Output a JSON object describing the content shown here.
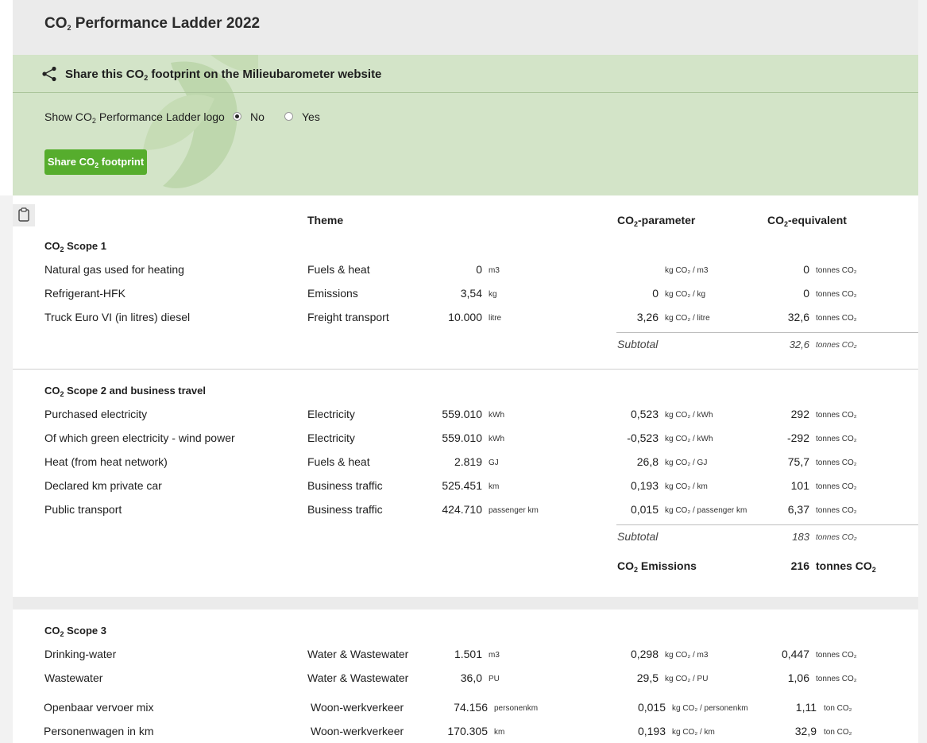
{
  "page_title": {
    "pre": "CO",
    "sub": "2",
    "post": " Performance Ladder 2022"
  },
  "share": {
    "title": {
      "pre": "Share this CO",
      "sub": "2",
      "post": " footprint on the Milieubarometer website"
    },
    "logo_label": {
      "pre": "Show CO",
      "sub": "2",
      "post": " Performance Ladder logo"
    },
    "options": [
      "No",
      "Yes"
    ],
    "selected": "No",
    "button": {
      "pre": "Share CO",
      "sub": "2",
      "post": " footprint"
    }
  },
  "columns": {
    "theme": "Theme",
    "param": {
      "pre": "CO",
      "sub": "2",
      "post": "-parameter"
    },
    "equiv": {
      "pre": "CO",
      "sub": "2",
      "post": "-equivalent"
    }
  },
  "sections": [
    {
      "title": {
        "pre": "CO",
        "sub": "2",
        "post": " Scope 1"
      },
      "rows": [
        {
          "name": "Natural gas used for heating",
          "theme": "Fuels & heat",
          "amount": "0",
          "unit": "m3",
          "factor": "",
          "factor_unit": "kg CO₂ / m3",
          "emission": "0",
          "emission_unit": "tonnes CO₂"
        },
        {
          "name": "Refrigerant-HFK",
          "theme": "Emissions",
          "amount": "3,54",
          "unit": "kg",
          "factor": "0",
          "factor_unit": "kg CO₂ / kg",
          "emission": "0",
          "emission_unit": "tonnes CO₂"
        },
        {
          "name": "Truck Euro VI (in litres) diesel",
          "theme": "Freight transport",
          "amount": "10.000",
          "unit": "litre",
          "factor": "3,26",
          "factor_unit": "kg CO₂ / litre",
          "emission": "32,6",
          "emission_unit": "tonnes CO₂"
        }
      ],
      "subtotal": {
        "label": "Subtotal",
        "value": "32,6",
        "unit": "tonnes CO₂"
      }
    },
    {
      "title": {
        "pre": "CO",
        "sub": "2",
        "post": " Scope 2 and business travel"
      },
      "rows": [
        {
          "name": "Purchased electricity",
          "theme": "Electricity",
          "amount": "559.010",
          "unit": "kWh",
          "factor": "0,523",
          "factor_unit": "kg CO₂ / kWh",
          "emission": "292",
          "emission_unit": "tonnes CO₂"
        },
        {
          "name": "Of which green electricity - wind power",
          "theme": "Electricity",
          "amount": "559.010",
          "unit": "kWh",
          "factor": "-0,523",
          "factor_unit": "kg CO₂ / kWh",
          "emission": "-292",
          "emission_unit": "tonnes CO₂"
        },
        {
          "name": "Heat (from heat network)",
          "theme": "Fuels & heat",
          "amount": "2.819",
          "unit": "GJ",
          "factor": "26,8",
          "factor_unit": "kg CO₂ / GJ",
          "emission": "75,7",
          "emission_unit": "tonnes CO₂"
        },
        {
          "name": "Declared km private car",
          "theme": "Business traffic",
          "amount": "525.451",
          "unit": "km",
          "factor": "0,193",
          "factor_unit": "kg CO₂ / km",
          "emission": "101",
          "emission_unit": "tonnes CO₂"
        },
        {
          "name": "Public transport",
          "theme": "Business traffic",
          "amount": "424.710",
          "unit": "passenger km",
          "factor": "0,015",
          "factor_unit": "kg CO₂ / passenger km",
          "emission": "6,37",
          "emission_unit": "tonnes CO₂"
        }
      ],
      "subtotal": {
        "label": "Subtotal",
        "value": "183",
        "unit": "tonnes CO₂"
      },
      "total": {
        "label": {
          "pre": "CO",
          "sub": "2",
          "post": " Emissions"
        },
        "value": "216",
        "unit": {
          "pre": "tonnes CO",
          "sub": "2",
          "post": ""
        }
      }
    },
    {
      "title": {
        "pre": "CO",
        "sub": "2",
        "post": " Scope 3"
      },
      "rows": [
        {
          "name": "Drinking-water",
          "theme": "Water & Wastewater",
          "amount": "1.501",
          "unit": "m3",
          "factor": "0,298",
          "factor_unit": "kg CO₂ / m3",
          "emission": "0,447",
          "emission_unit": "tonnes CO₂"
        },
        {
          "name": "Wastewater",
          "theme": "Water & Wastewater",
          "amount": "36,0",
          "unit": "PU",
          "factor": "29,5",
          "factor_unit": "kg CO₂ / PU",
          "emission": "1,06",
          "emission_unit": "tonnes CO₂"
        }
      ]
    }
  ],
  "extra_rows": [
    {
      "name": "Openbaar vervoer mix",
      "theme": "Woon-werkverkeer",
      "amount": "74.156",
      "unit": "personenkm",
      "factor": "0,015",
      "factor_unit": "kg CO₂ / personenkm",
      "emission": "1,11",
      "emission_unit": "ton CO₂"
    },
    {
      "name": "Personenwagen in km",
      "theme": "Woon-werkverkeer",
      "amount": "170.305",
      "unit": "km",
      "factor": "0,193",
      "factor_unit": "kg CO₂ / km",
      "emission": "32,9",
      "emission_unit": "ton CO₂"
    }
  ],
  "colors": {
    "accent_green": "#56ad2d",
    "panel_green": "#d3e4c8",
    "band_grey": "#ebebeb"
  }
}
